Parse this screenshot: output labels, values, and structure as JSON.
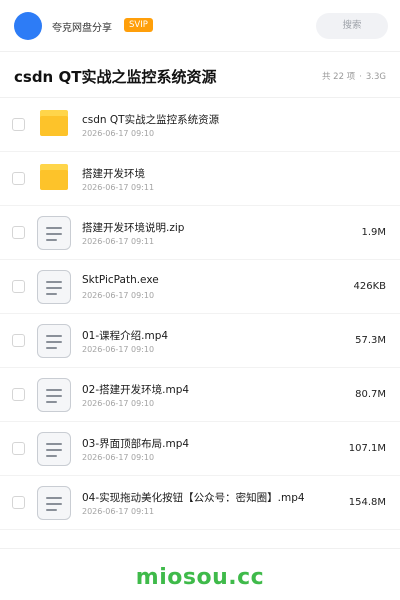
{
  "header": {
    "brand": "夸克网盘分享",
    "badge": "SVIP",
    "search_label": "搜索"
  },
  "folder": {
    "title": "csdn QT实战之监控系统资源",
    "count": "共 22 项",
    "sep": "·",
    "total_size": "3.3G"
  },
  "files": [
    {
      "type": "folder",
      "name": "csdn QT实战之监控系统资源",
      "date": "2026-06-17 09:10",
      "size": ""
    },
    {
      "type": "folder",
      "name": "搭建开发环境",
      "date": "2026-06-17 09:11",
      "size": ""
    },
    {
      "type": "file",
      "name": "搭建开发环境说明.zip",
      "date": "2026-06-17 09:11",
      "size": "1.9M"
    },
    {
      "type": "file",
      "name": "SktPicPath.exe",
      "date": "2026-06-17 09:10",
      "size": "426KB"
    },
    {
      "type": "file",
      "name": "01-课程介绍.mp4",
      "date": "2026-06-17 09:10",
      "size": "57.3M"
    },
    {
      "type": "file",
      "name": "02-搭建开发环境.mp4",
      "date": "2026-06-17 09:10",
      "size": "80.7M"
    },
    {
      "type": "file",
      "name": "03-界面顶部布局.mp4",
      "date": "2026-06-17 09:10",
      "size": "107.1M"
    },
    {
      "type": "file",
      "name": "04-实现拖动美化按钮【公众号：密知圈】.mp4",
      "date": "2026-06-17 09:11",
      "size": "154.8M"
    }
  ],
  "watermark": "miosou.cc",
  "colors": {
    "avatar": "#2d7cf6",
    "badge": "#ff9f0a",
    "folder": "#fdc32a",
    "watermark": "#3fba4a"
  }
}
